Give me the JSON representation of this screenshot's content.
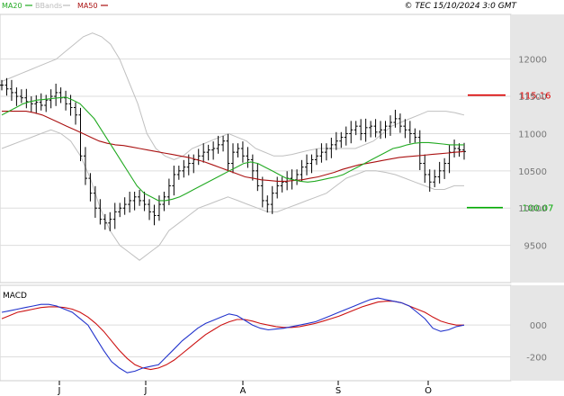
{
  "header": {
    "legend": [
      {
        "label": "MA20",
        "color": "#22aa22"
      },
      {
        "label": "BBands",
        "color": "#bbbbbb"
      },
      {
        "label": "MA50",
        "color": "#aa1111"
      }
    ],
    "source": "© TEC 15/10/2024 3:0 GMT"
  },
  "colors": {
    "price": "#000000",
    "ma20": "#22aa22",
    "ma50": "#aa1111",
    "bbands": "#c0c0c0",
    "grid": "#dddddd",
    "panel_bg": "#e6e6e6",
    "resistance": "#dd0000",
    "support": "#00aa00",
    "macd_line": "#2233cc",
    "macd_signal": "#cc1111"
  },
  "chart_data": [
    {
      "type": "ohlc",
      "x_months": [
        "J",
        "J",
        "A",
        "S",
        "O"
      ],
      "ylim": [
        9000,
        12600
      ],
      "yticks": [
        "12000",
        "11500",
        "11000",
        "10500",
        "10000",
        "9500"
      ],
      "yticks_values": [
        12000,
        11500,
        11000,
        10500,
        10000,
        9500
      ],
      "levels": [
        {
          "label": "115.16",
          "value": 11516,
          "color": "#dd0000"
        },
        {
          "label": "100.07",
          "value": 10007,
          "color": "#00aa00"
        }
      ],
      "close": [
        11650,
        11600,
        11550,
        11500,
        11480,
        11430,
        11400,
        11420,
        11380,
        11450,
        11500,
        11550,
        11480,
        11400,
        11350,
        11250,
        10700,
        10400,
        10200,
        10000,
        9850,
        9800,
        9850,
        9950,
        10000,
        10050,
        10100,
        10150,
        10100,
        10050,
        9950,
        9900,
        10050,
        10150,
        10300,
        10450,
        10500,
        10550,
        10600,
        10650,
        10700,
        10750,
        10780,
        10800,
        10850,
        10900,
        10600,
        10750,
        10800,
        10700,
        10650,
        10500,
        10300,
        10100,
        10050,
        10200,
        10300,
        10350,
        10400,
        10380,
        10450,
        10550,
        10600,
        10650,
        10700,
        10750,
        10800,
        10850,
        10900,
        10950,
        11000,
        11050,
        11100,
        11000,
        11080,
        11100,
        11020,
        11050,
        11100,
        11150,
        11200,
        11100,
        11050,
        11000,
        10950,
        10600,
        10450,
        10350,
        10420,
        10500,
        10600,
        10750,
        10800,
        10780,
        10760
      ],
      "ma20": [
        11250,
        11300,
        11350,
        11400,
        11430,
        11450,
        11460,
        11470,
        11480,
        11490,
        11450,
        11400,
        11300,
        11200,
        11050,
        10900,
        10750,
        10600,
        10450,
        10300,
        10200,
        10150,
        10100,
        10100,
        10120,
        10150,
        10200,
        10250,
        10300,
        10350,
        10400,
        10450,
        10500,
        10550,
        10600,
        10620,
        10600,
        10550,
        10500,
        10450,
        10400,
        10380,
        10360,
        10350,
        10360,
        10380,
        10400,
        10420,
        10450,
        10500,
        10550,
        10600,
        10650,
        10700,
        10750,
        10800,
        10820,
        10850,
        10870,
        10880,
        10880,
        10870,
        10860,
        10850,
        10850,
        10850
      ],
      "ma50": [
        11300,
        11300,
        11300,
        11300,
        11280,
        11250,
        11200,
        11150,
        11100,
        11050,
        11000,
        10950,
        10900,
        10870,
        10850,
        10840,
        10820,
        10800,
        10780,
        10760,
        10740,
        10720,
        10700,
        10680,
        10650,
        10620,
        10580,
        10540,
        10500,
        10460,
        10420,
        10400,
        10380,
        10370,
        10360,
        10360,
        10370,
        10380,
        10400,
        10420,
        10450,
        10480,
        10520,
        10550,
        10580,
        10600,
        10620,
        10640,
        10660,
        10680,
        10690,
        10700,
        10710,
        10720,
        10730,
        10740,
        10750,
        10760
      ],
      "bb_upper": [
        11700,
        11750,
        11800,
        11850,
        11900,
        11950,
        12000,
        12100,
        12200,
        12300,
        12350,
        12300,
        12200,
        12000,
        11700,
        11400,
        11000,
        10800,
        10700,
        10650,
        10700,
        10800,
        10850,
        10900,
        10950,
        11000,
        10950,
        10900,
        10800,
        10750,
        10700,
        10700,
        10720,
        10750,
        10780,
        10800,
        10800,
        10800,
        10800,
        10800,
        10850,
        10900,
        11000,
        11100,
        11150,
        11200,
        11250,
        11300,
        11300,
        11300,
        11280,
        11250
      ],
      "bb_lower": [
        10800,
        10850,
        10900,
        10950,
        11000,
        11050,
        11000,
        10900,
        10700,
        10400,
        10000,
        9700,
        9500,
        9400,
        9300,
        9400,
        9500,
        9700,
        9800,
        9900,
        10000,
        10050,
        10100,
        10150,
        10100,
        10050,
        10000,
        9950,
        9950,
        10000,
        10050,
        10100,
        10150,
        10200,
        10300,
        10400,
        10450,
        10500,
        10500,
        10480,
        10450,
        10400,
        10350,
        10300,
        10250,
        10250,
        10300,
        10300
      ]
    },
    {
      "type": "line",
      "title": "MACD",
      "ylim": [
        -350,
        250
      ],
      "yticks": [
        "000",
        "-200"
      ],
      "yticks_values": [
        0,
        -200
      ],
      "series": [
        {
          "values": [
            80,
            90,
            100,
            110,
            120,
            130,
            130,
            120,
            100,
            80,
            40,
            0,
            -80,
            -160,
            -230,
            -270,
            -300,
            -290,
            -270,
            -260,
            -250,
            -200,
            -150,
            -100,
            -60,
            -20,
            10,
            30,
            50,
            70,
            60,
            30,
            0,
            -20,
            -30,
            -25,
            -20,
            -10,
            0,
            10,
            20,
            40,
            60,
            80,
            100,
            120,
            140,
            160,
            170,
            160,
            150,
            140,
            120,
            80,
            40,
            -20,
            -40,
            -30,
            -10,
            0
          ]
        },
        {
          "values": [
            40,
            60,
            80,
            90,
            100,
            110,
            115,
            115,
            110,
            100,
            80,
            50,
            10,
            -40,
            -100,
            -160,
            -210,
            -250,
            -270,
            -280,
            -270,
            -250,
            -220,
            -180,
            -140,
            -100,
            -60,
            -30,
            0,
            20,
            35,
            35,
            25,
            10,
            0,
            -10,
            -15,
            -15,
            -10,
            0,
            10,
            25,
            40,
            55,
            75,
            95,
            115,
            130,
            145,
            150,
            150,
            140,
            120,
            100,
            80,
            50,
            25,
            10,
            0,
            0
          ]
        }
      ]
    }
  ]
}
